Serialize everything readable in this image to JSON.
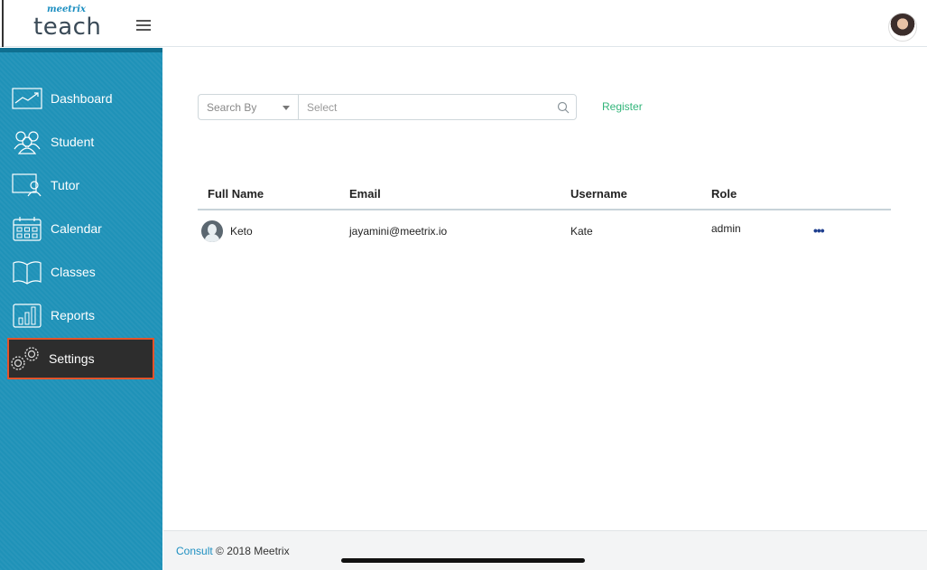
{
  "header": {
    "brand_small": "meetrix",
    "brand": "teach"
  },
  "sidebar": {
    "items": [
      {
        "label": "Dashboard",
        "icon": "chart-line-icon"
      },
      {
        "label": "Student",
        "icon": "users-icon"
      },
      {
        "label": "Tutor",
        "icon": "tutor-board-icon"
      },
      {
        "label": "Calendar",
        "icon": "calendar-icon"
      },
      {
        "label": "Classes",
        "icon": "book-open-icon"
      },
      {
        "label": "Reports",
        "icon": "bar-chart-icon"
      },
      {
        "label": "Settings",
        "icon": "gears-icon",
        "active": true
      }
    ]
  },
  "search": {
    "search_by_label": "Search By",
    "placeholder": "Select"
  },
  "register_label": "Register",
  "table": {
    "columns": [
      "Full Name",
      "Email",
      "Username",
      "Role"
    ],
    "rows": [
      {
        "full_name": "Keto",
        "email": "jayamini@meetrix.io",
        "username": "Kate",
        "role": "admin",
        "actions": "•••"
      }
    ]
  },
  "footer": {
    "link": "Consult",
    "text": "© 2018 Meetrix"
  },
  "colors": {
    "sidebar": "#1f92b8",
    "active_item_bg": "#2d2d2d",
    "active_item_border": "#e2542b",
    "register_link": "#32b57a",
    "footer_link": "#1d8fc1"
  }
}
